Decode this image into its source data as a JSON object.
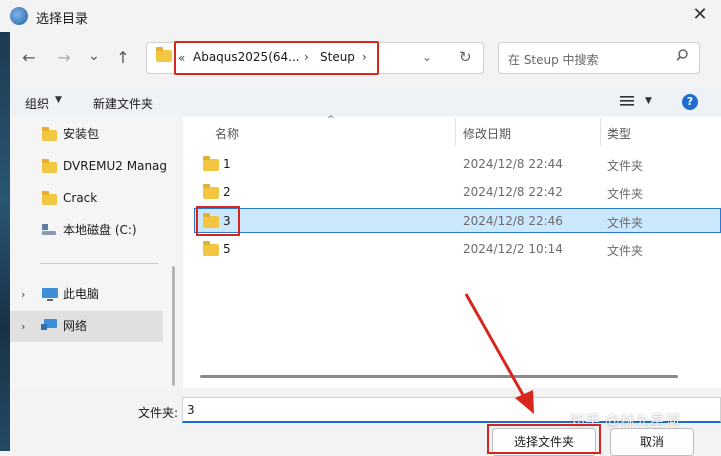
{
  "window": {
    "title": "选择目录",
    "close": "✕"
  },
  "nav": {
    "back": "←",
    "forward": "→",
    "recent": "⌄",
    "up": "↑"
  },
  "address": {
    "lead": "«",
    "crumbs": [
      "Abaqus2025(64...",
      "Steup"
    ],
    "sep": "›",
    "dropdown": "⌄",
    "refresh": "↻"
  },
  "search": {
    "placeholder": "在 Steup 中搜索"
  },
  "toolbar": {
    "organize": "组织",
    "caret": "▼",
    "new_folder": "新建文件夹",
    "help": "?"
  },
  "sidebar": {
    "items": [
      {
        "label": "安装包"
      },
      {
        "label": "DVREMU2 Manag"
      },
      {
        "label": "Crack"
      },
      {
        "label": "本地磁盘 (C:)"
      },
      {
        "label": "此电脑"
      },
      {
        "label": "网络"
      }
    ],
    "chevron": "›"
  },
  "list": {
    "columns": {
      "name": "名称",
      "modified": "修改日期",
      "type": "类型"
    },
    "sort_indicator": "^",
    "rows": [
      {
        "name": "1",
        "modified": "2024/12/8 22:44",
        "type": "文件夹",
        "selected": false
      },
      {
        "name": "2",
        "modified": "2024/12/8 22:42",
        "type": "文件夹",
        "selected": false
      },
      {
        "name": "3",
        "modified": "2024/12/8 22:46",
        "type": "文件夹",
        "selected": true
      },
      {
        "name": "5",
        "modified": "2024/12/2 10:14",
        "type": "文件夹",
        "selected": false
      }
    ]
  },
  "footer": {
    "folder_label": "文件夹:",
    "folder_value": "3",
    "select_button": "选择文件夹",
    "cancel_button": "取消"
  },
  "watermark": "知乎 @林允星河",
  "colors": {
    "annotation": "#d8261e",
    "accent": "#1c6fd1",
    "selection": "#cce8ff",
    "folder": "#f3c641"
  }
}
